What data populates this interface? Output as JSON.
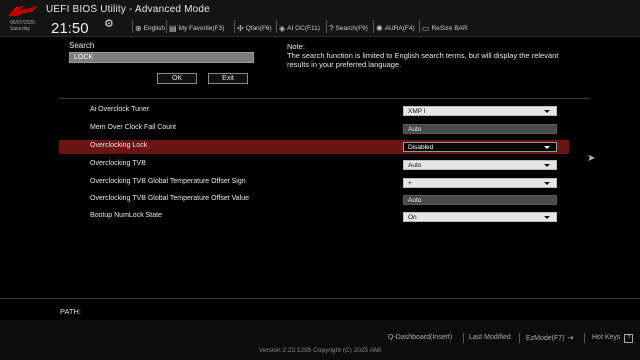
{
  "header": {
    "title": "UEFI BIOS Utility - Advanced Mode",
    "date": "06/07/2025",
    "day": "Saturday",
    "time": "21:50",
    "items": [
      {
        "icon": "globe-icon",
        "label": "English"
      },
      {
        "icon": "favorite-icon",
        "label": "My Favorite(F3)"
      },
      {
        "icon": "fan-icon",
        "label": "Qfan(F6)"
      },
      {
        "icon": "ai-oc-icon",
        "label": "AI OC(F11)"
      },
      {
        "icon": "search-icon",
        "label": "Search(F9)"
      },
      {
        "icon": "aura-icon",
        "label": "AURA(F4)"
      },
      {
        "icon": "resize-bar-icon",
        "label": "ReSize BAR"
      }
    ]
  },
  "search": {
    "label": "Search",
    "value": "LOCK",
    "ok_label": "OK",
    "exit_label": "Exit",
    "note_title": "Note:",
    "note_text": "The search function is limited to English search terms, but will display the relevant results in your preferred language."
  },
  "settings": [
    {
      "label": "Ai Overclock Tuner",
      "value": "XMP I",
      "type": "dropdown"
    },
    {
      "label": "Mem Over Clock Fail Count",
      "value": "Auto",
      "type": "readonly"
    },
    {
      "label": "Overclocking Lock",
      "value": "Disabled",
      "type": "dropdown",
      "selected": true
    },
    {
      "label": "Overclocking TVB",
      "value": "Auto",
      "type": "dropdown"
    },
    {
      "label": "Overclocking TVB Global Temperature Offset Sign",
      "value": "+",
      "type": "dropdown"
    },
    {
      "label": "Overclocking TVB Global Temperature Offset Value",
      "value": "Auto",
      "type": "readonly"
    },
    {
      "label": "Bootup NumLock State",
      "value": "On",
      "type": "dropdown"
    }
  ],
  "path_label": "PATH:",
  "footer": {
    "items": [
      "Q-Dashboard(Insert)",
      "Last Modified",
      "EzMode(F7)",
      "Hot Keys"
    ],
    "version": "Version 2.22.1295 Copyright (C) 2025 AMI"
  },
  "colors": {
    "selected_row": "#6a1414",
    "background": "#000000",
    "accent": "#b00000"
  }
}
